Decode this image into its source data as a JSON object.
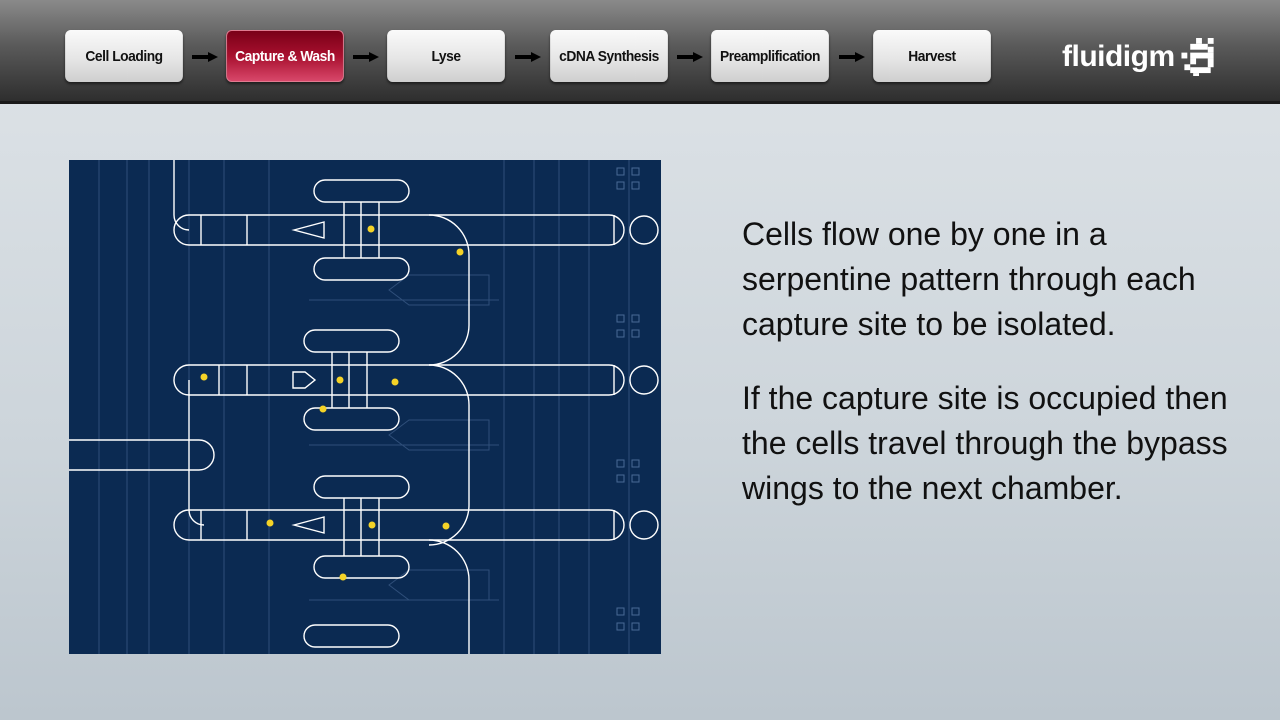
{
  "workflow": {
    "steps": [
      {
        "label": "Cell Loading",
        "active": false
      },
      {
        "label": "Capture & Wash",
        "active": true
      },
      {
        "label": "Lyse",
        "active": false
      },
      {
        "label": "cDNA Synthesis",
        "active": false
      },
      {
        "label": "Preamplification",
        "active": false
      },
      {
        "label": "Harvest",
        "active": false
      }
    ]
  },
  "logo": {
    "text": "Fluidigm"
  },
  "colors": {
    "active_step": "#a8102e",
    "diagram_bg": "#0b2a52",
    "cell": "#f5d327"
  },
  "body": {
    "paragraph1": "Cells flow one by one in a serpentine pattern through each capture site to be isolated.",
    "paragraph2": "If the capture site is occupied then the cells travel through the bypass wings to the next chamber."
  }
}
